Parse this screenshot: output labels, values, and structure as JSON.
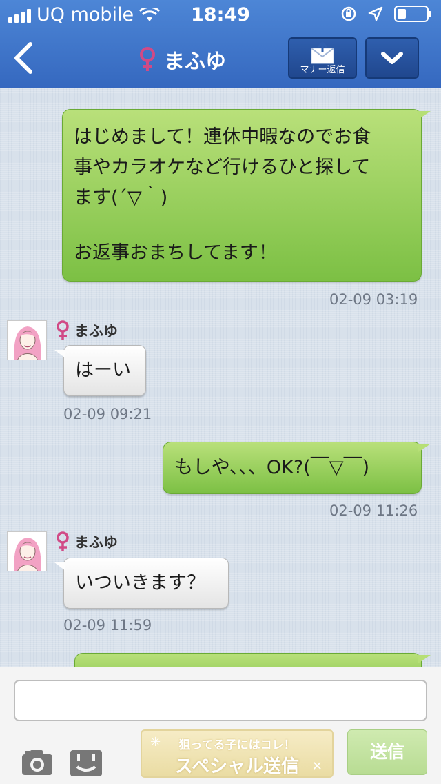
{
  "status_bar": {
    "carrier": "UQ mobile",
    "time": "18:49",
    "battery_level": 0.3
  },
  "header": {
    "title": "まふゆ",
    "manner_reply_label": "マナー返信",
    "colors": {
      "bar": "#3f78cc",
      "female_symbol": "#d14a86"
    }
  },
  "messages": [
    {
      "direction": "outgoing",
      "lines": [
        "はじめまして！連休中暇なのでお食",
        "事やカラオケなど行けるひと探して",
        "ます(´▽｀)",
        "",
        "お返事おまちしてます！"
      ],
      "time": "02-09 03:19"
    },
    {
      "direction": "incoming",
      "sender": "まふゆ",
      "lines": [
        "はーい"
      ],
      "time": "02-09 09:21"
    },
    {
      "direction": "outgoing",
      "lines": [
        "もしや、、、OK?(￣▽￣)"
      ],
      "time": "02-09 11:26"
    },
    {
      "direction": "incoming",
      "sender": "まふゆ",
      "lines": [
        "いついきます？"
      ],
      "time": "02-09 11:59"
    }
  ],
  "composer": {
    "input_value": "",
    "special_top": "狙ってる子にはコレ！",
    "special_main": "スペシャル送信",
    "send_label": "送信"
  },
  "icons": [
    "back-chevron-icon",
    "female-symbol-icon",
    "envelope-upload-icon",
    "chevron-down-icon",
    "camera-icon",
    "stamp-icon",
    "wifi-icon",
    "location-icon",
    "rotation-lock-icon"
  ]
}
